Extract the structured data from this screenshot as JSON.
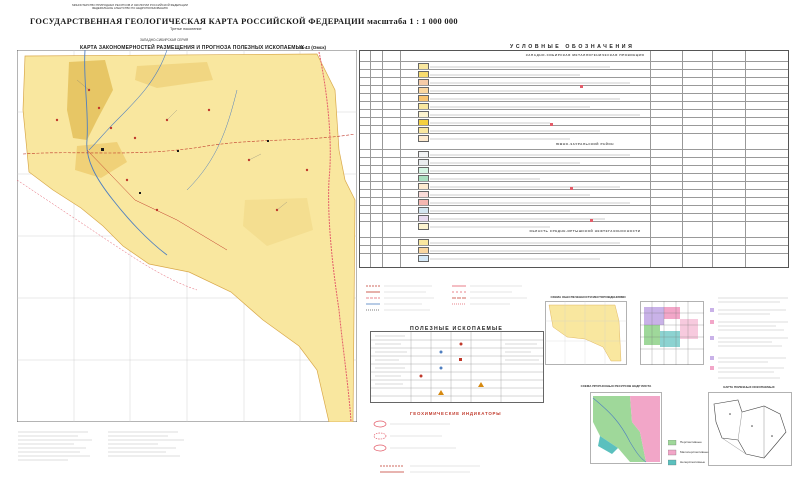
{
  "header": {
    "ministry_lines": [
      "МИНИСТЕРСТВО ПРИРОДНЫХ РЕСУРСОВ И ЭКОЛОГИИ РОССИЙСКОЙ ФЕДЕРАЦИИ",
      "ФЕДЕРАЛЬНОЕ АГЕНТСТВО ПО НЕДРОПОЛЬЗОВАНИЮ"
    ],
    "main_title": "ГОСУДАРСТВЕННАЯ ГЕОЛОГИЧЕСКАЯ КАРТА РОССИЙСКОЙ ФЕДЕРАЦИИ масштаба 1 : 1 000 000",
    "edition": "Третье поколение",
    "series": "ЗАПАДНО-СИБИРСКАЯ СЕРИЯ",
    "map_title": "КАРТА ЗАКОНОМЕРНОСТЕЙ РАЗМЕЩЕНИЯ И ПРОГНОЗА ПОЛЕЗНЫХ ИСКОПАЕМЫХ",
    "sheet_id": "N-43 (Омск)"
  },
  "legend": {
    "title": "УСЛОВНЫЕ ОБОЗНАЧЕНИЯ",
    "section_heads": [
      "ЗАПАДНО-СИБИРСКАЯ МЕТАЛЛОГЕНИЧЕСКАЯ ПРОВИНЦИЯ",
      "ЮЖНО-ЗАУРАЛЬСКИЙ РАЙОН",
      "ОБЛАСТЬ СРЕДНЕ-ИРТЫШСКОЙ НЕФТЕГАЗОНОСНОСТИ"
    ]
  },
  "symbols": {
    "title": "ПОЛЕЗНЫЕ ИСКОПАЕМЫЕ"
  },
  "insets": {
    "geo_indicators_title": "ГЕОХИМИЧЕСКИЕ ИНДИКАТОРЫ",
    "inset1_title": "СХЕМА ОБЕСПЕЧЕННОСТИ МЕСТОРОЖДЕНИЯМИ",
    "inset3_title": "СХЕМА ПРОГНОЗНЫХ РЕСУРСОВ НЕДР ЛИСТА",
    "inset4_title": "КАРТА ПОЛЕЗНЫХ ИСКОПАЕМЫХ",
    "inset_legend": [
      "Перспективные",
      "Малоперспективные",
      "Неперспективные"
    ]
  },
  "colors": {
    "map_fill": "#f9e79f",
    "map_dark": "#e4c05a",
    "river": "#4f7fc0",
    "road": "#c0392b",
    "boundary": "#e35d6a",
    "legend_red": "#c0392b",
    "inset_green": "#9fd89a",
    "inset_pink": "#f2a6c8",
    "inset_lilac": "#c9b2e8",
    "inset_teal": "#5bc0be"
  }
}
